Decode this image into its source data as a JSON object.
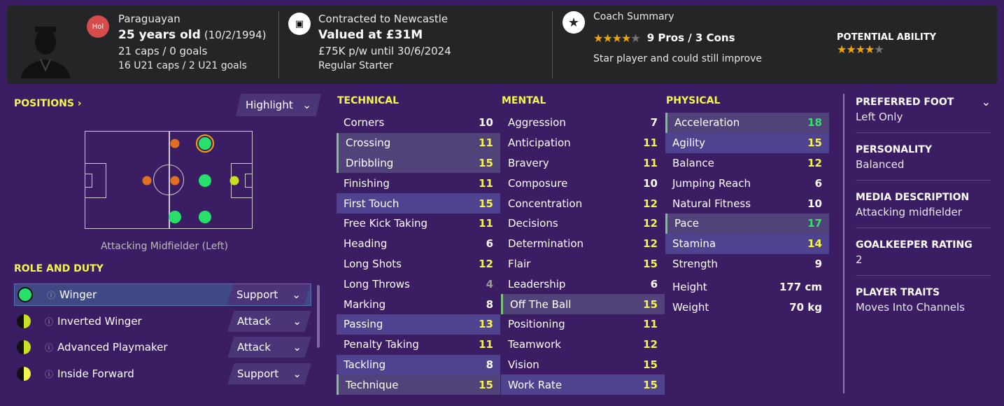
{
  "header": {
    "nation_badge": "Hol",
    "nationality": "Paraguayan",
    "age": "25 years old",
    "dob": "(10/2/1994)",
    "caps": "21 caps / 0 goals",
    "u21": "16 U21 caps / 2 U21 goals",
    "contract": "Contracted to Newcastle",
    "value": "Valued at £31M",
    "wage": "£75K p/w until 30/6/2024",
    "status": "Regular Starter",
    "coach_title": "Coach Summary",
    "coach_stars": 4,
    "pros_cons": "9 Pros / 3 Cons",
    "coach_note": "Star player and could still improve",
    "pa_title": "POTENTIAL ABILITY",
    "pa_stars": 4
  },
  "positions": {
    "title": "POSITIONS",
    "highlight": "Highlight",
    "label": "Attacking Midfielder (Left)"
  },
  "roles": {
    "title": "ROLE AND DUTY",
    "items": [
      {
        "name": "Winger",
        "duty": "Support"
      },
      {
        "name": "Inverted Winger",
        "duty": "Attack"
      },
      {
        "name": "Advanced Playmaker",
        "duty": "Attack"
      },
      {
        "name": "Inside Forward",
        "duty": "Support"
      }
    ]
  },
  "technical": {
    "title": "TECHNICAL",
    "rows": [
      [
        "Corners",
        "10"
      ],
      [
        "Crossing",
        "11"
      ],
      [
        "Dribbling",
        "15"
      ],
      [
        "Finishing",
        "11"
      ],
      [
        "First Touch",
        "15"
      ],
      [
        "Free Kick Taking",
        "11"
      ],
      [
        "Heading",
        "6"
      ],
      [
        "Long Shots",
        "12"
      ],
      [
        "Long Throws",
        "4"
      ],
      [
        "Marking",
        "8"
      ],
      [
        "Passing",
        "13"
      ],
      [
        "Penalty Taking",
        "11"
      ],
      [
        "Tackling",
        "8"
      ],
      [
        "Technique",
        "15"
      ]
    ]
  },
  "mental": {
    "title": "MENTAL",
    "rows": [
      [
        "Aggression",
        "7"
      ],
      [
        "Anticipation",
        "11"
      ],
      [
        "Bravery",
        "11"
      ],
      [
        "Composure",
        "10"
      ],
      [
        "Concentration",
        "12"
      ],
      [
        "Decisions",
        "12"
      ],
      [
        "Determination",
        "12"
      ],
      [
        "Flair",
        "15"
      ],
      [
        "Leadership",
        "6"
      ],
      [
        "Off The Ball",
        "15"
      ],
      [
        "Positioning",
        "11"
      ],
      [
        "Teamwork",
        "12"
      ],
      [
        "Vision",
        "15"
      ],
      [
        "Work Rate",
        "15"
      ]
    ]
  },
  "physical": {
    "title": "PHYSICAL",
    "rows": [
      [
        "Acceleration",
        "18"
      ],
      [
        "Agility",
        "15"
      ],
      [
        "Balance",
        "12"
      ],
      [
        "Jumping Reach",
        "6"
      ],
      [
        "Natural Fitness",
        "10"
      ],
      [
        "Pace",
        "17"
      ],
      [
        "Stamina",
        "14"
      ],
      [
        "Strength",
        "9"
      ]
    ],
    "height_label": "Height",
    "height": "177 cm",
    "weight_label": "Weight",
    "weight": "70 kg"
  },
  "info": {
    "foot_label": "PREFERRED FOOT",
    "foot": "Left Only",
    "personality_label": "PERSONALITY",
    "personality": "Balanced",
    "media_label": "MEDIA DESCRIPTION",
    "media": "Attacking midfielder",
    "gk_label": "GOALKEEPER RATING",
    "gk": "2",
    "traits_label": "PLAYER TRAITS",
    "traits": "Moves Into Channels"
  },
  "colors": {
    "natural": "#26e06a",
    "accomplished": "#c8e024",
    "unconvincing": "#e07020",
    "yellow": "#f4f54e"
  }
}
